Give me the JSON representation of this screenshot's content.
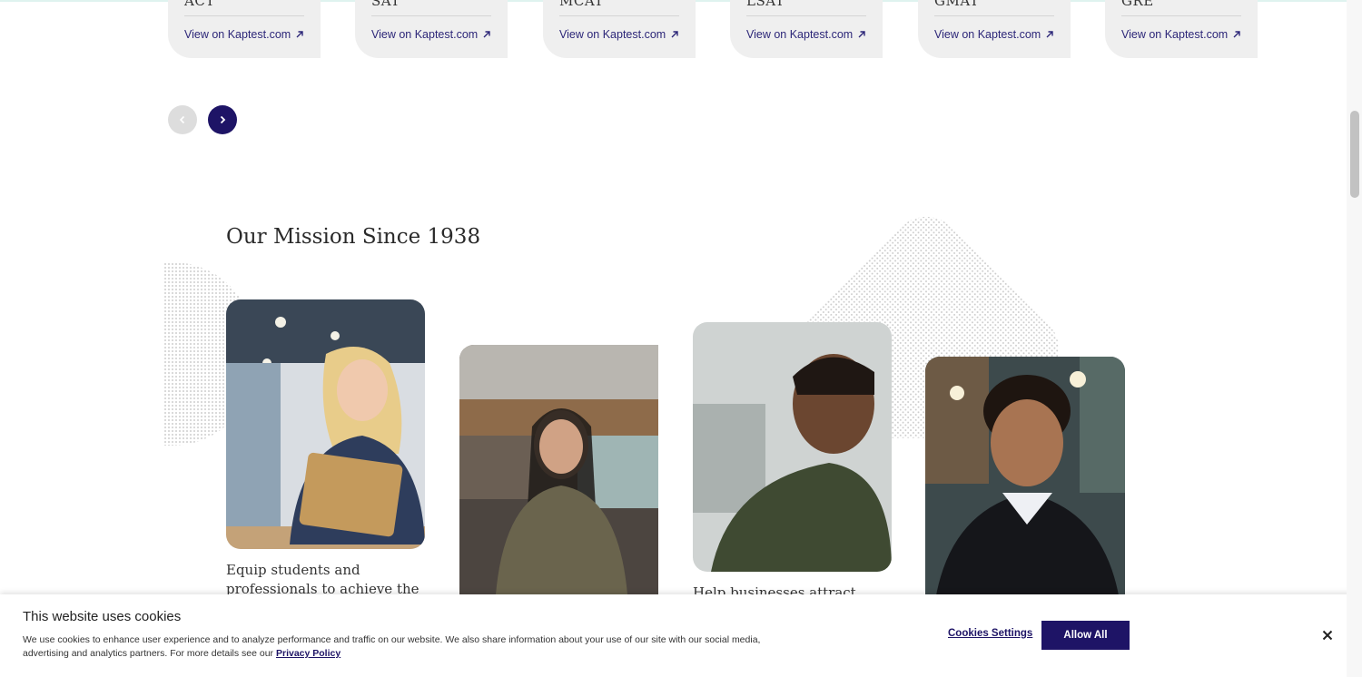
{
  "tests": [
    {
      "name": "ACT",
      "link": "View on Kaptest.com"
    },
    {
      "name": "SAT",
      "link": "View on Kaptest.com"
    },
    {
      "name": "MCAT",
      "link": "View on Kaptest.com"
    },
    {
      "name": "LSAT",
      "link": "View on Kaptest.com"
    },
    {
      "name": "GMAT",
      "link": "View on Kaptest.com"
    },
    {
      "name": "GRE",
      "link": "View on Kaptest.com"
    }
  ],
  "carousel": {
    "prev_icon": "chevron-left-icon",
    "next_icon": "chevron-right-icon"
  },
  "mission": {
    "title": "Our Mission Since 1938",
    "captions": [
      "Equip students and professionals to achieve the",
      "Help businesses attract new"
    ]
  },
  "cookie_banner": {
    "title": "This website uses cookies",
    "body": "We use cookies to enhance user experience and to analyze performance and traffic on our website. We also share information about your use of our site with our social media, advertising and analytics partners. For more details see our",
    "privacy_link": "Privacy Policy",
    "settings_label": "Cookies Settings",
    "allow_label": "Allow All",
    "close_icon": "close-icon"
  },
  "colors": {
    "brand": "#1e1466",
    "card_bg": "#efefef"
  }
}
